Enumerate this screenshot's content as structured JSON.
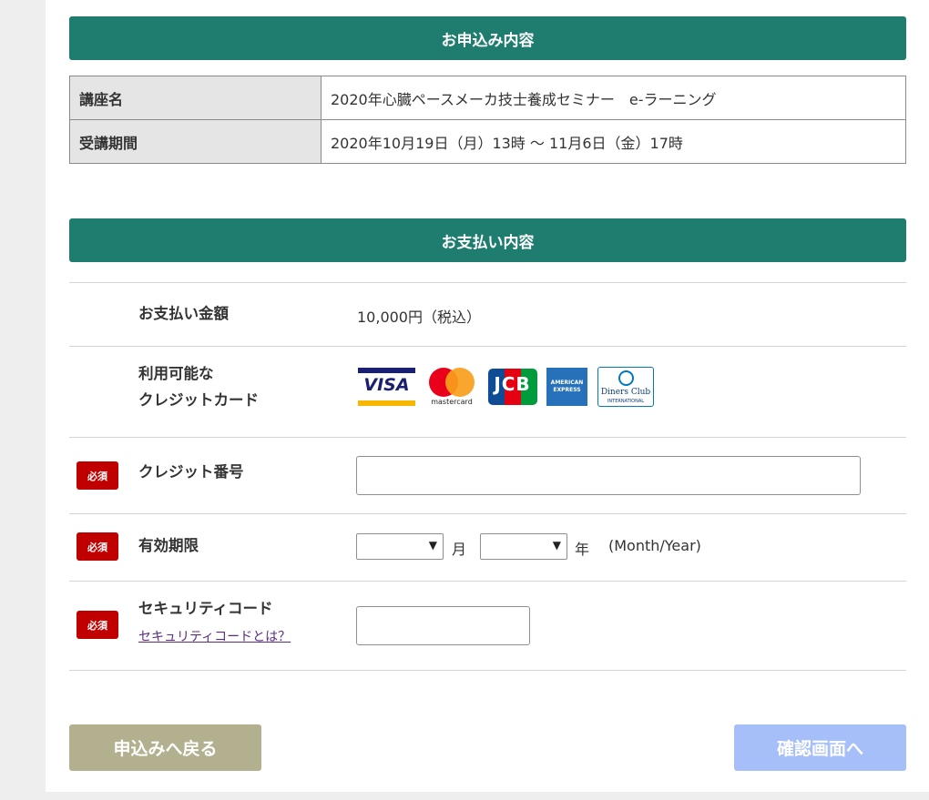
{
  "application_section": {
    "title": "お申込み内容",
    "rows": [
      {
        "label": "講座名",
        "value": "2020年心臓ペースメーカ技士養成セミナー　e-ラーニング"
      },
      {
        "label": "受講期間",
        "value": "2020年10月19日（月）13時 ～ 11月6日（金）17時"
      }
    ]
  },
  "payment_section": {
    "title": "お支払い内容",
    "amount_label": "お支払い金額",
    "amount_value": "10,000円（税込）",
    "cards_label_line1": "利用可能な",
    "cards_label_line2": "クレジットカード",
    "cards": {
      "visa": "VISA",
      "mastercard": "mastercard",
      "jcb": "JCB",
      "amex_line1": "AMERICAN",
      "amex_line2": "EXPRESS",
      "diners": "Diners Club",
      "diners_sub": "INTERNATIONAL"
    },
    "required_badge": "必須",
    "card_number_label": "クレジット番号",
    "card_number_value": "",
    "expiry_label": "有効期限",
    "expiry_month_value": "",
    "expiry_month_unit": "月",
    "expiry_year_value": "",
    "expiry_year_unit": "年",
    "expiry_hint": "(Month/Year)",
    "security_code_label": "セキュリティコード",
    "security_code_link": "セキュリティコードとは？",
    "security_code_value": ""
  },
  "buttons": {
    "back": "申込みへ戻る",
    "confirm": "確認画面へ"
  },
  "colors": {
    "header_green": "#1e7d6f",
    "required_red": "#c00000",
    "back_button": "#b3b08f",
    "confirm_button": "#a7bff8"
  }
}
